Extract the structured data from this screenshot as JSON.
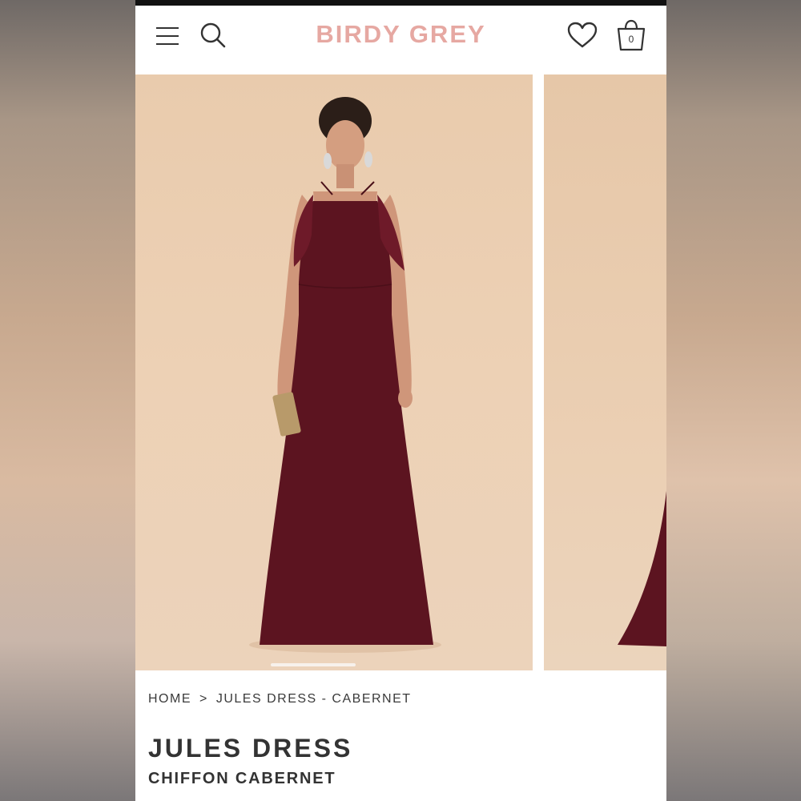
{
  "header": {
    "brand": "BIRDY GREY",
    "menu_icon": "hamburger-menu-icon",
    "search_icon": "search-icon",
    "wishlist_icon": "heart-icon",
    "bag_icon": "shopping-bag-icon",
    "bag_count": "0",
    "brand_color": "#e6a8a2"
  },
  "gallery": {
    "slides": [
      {
        "alt": "model wearing cabernet halter ruffle maxi dress holding gold clutch"
      },
      {
        "alt": "dress hem partial view"
      }
    ],
    "active_slide": 1,
    "slide_count": 2
  },
  "breadcrumb": {
    "home": "HOME",
    "separator": ">",
    "current": "JULES DRESS - CABERNET"
  },
  "product": {
    "title": "JULES DRESS",
    "subtitle": "CHIFFON CABERNET",
    "dress_color": "#5c1420"
  }
}
